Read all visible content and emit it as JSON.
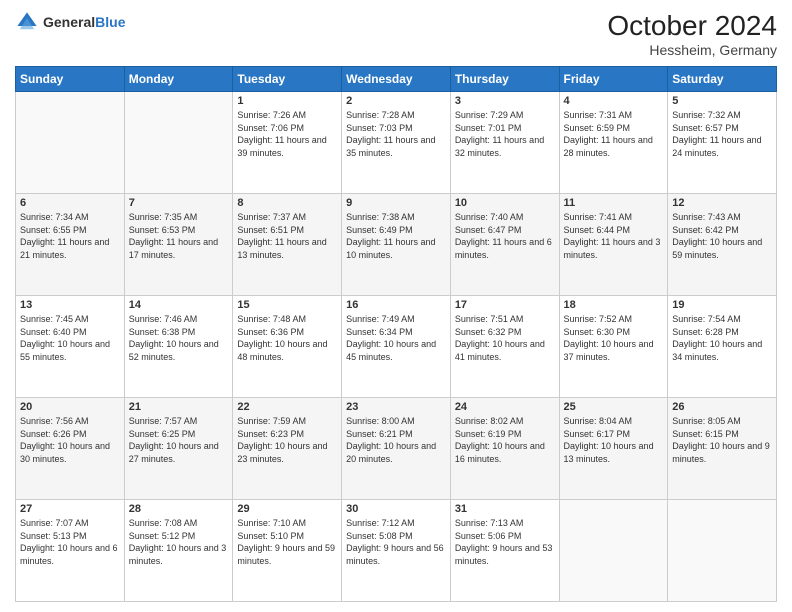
{
  "header": {
    "logo_line1": "General",
    "logo_line2": "Blue",
    "month_title": "October 2024",
    "location": "Hessheim, Germany"
  },
  "days_of_week": [
    "Sunday",
    "Monday",
    "Tuesday",
    "Wednesday",
    "Thursday",
    "Friday",
    "Saturday"
  ],
  "weeks": [
    [
      {
        "day": "",
        "sunrise": "",
        "sunset": "",
        "daylight": ""
      },
      {
        "day": "",
        "sunrise": "",
        "sunset": "",
        "daylight": ""
      },
      {
        "day": "1",
        "sunrise": "Sunrise: 7:26 AM",
        "sunset": "Sunset: 7:06 PM",
        "daylight": "Daylight: 11 hours and 39 minutes."
      },
      {
        "day": "2",
        "sunrise": "Sunrise: 7:28 AM",
        "sunset": "Sunset: 7:03 PM",
        "daylight": "Daylight: 11 hours and 35 minutes."
      },
      {
        "day": "3",
        "sunrise": "Sunrise: 7:29 AM",
        "sunset": "Sunset: 7:01 PM",
        "daylight": "Daylight: 11 hours and 32 minutes."
      },
      {
        "day": "4",
        "sunrise": "Sunrise: 7:31 AM",
        "sunset": "Sunset: 6:59 PM",
        "daylight": "Daylight: 11 hours and 28 minutes."
      },
      {
        "day": "5",
        "sunrise": "Sunrise: 7:32 AM",
        "sunset": "Sunset: 6:57 PM",
        "daylight": "Daylight: 11 hours and 24 minutes."
      }
    ],
    [
      {
        "day": "6",
        "sunrise": "Sunrise: 7:34 AM",
        "sunset": "Sunset: 6:55 PM",
        "daylight": "Daylight: 11 hours and 21 minutes."
      },
      {
        "day": "7",
        "sunrise": "Sunrise: 7:35 AM",
        "sunset": "Sunset: 6:53 PM",
        "daylight": "Daylight: 11 hours and 17 minutes."
      },
      {
        "day": "8",
        "sunrise": "Sunrise: 7:37 AM",
        "sunset": "Sunset: 6:51 PM",
        "daylight": "Daylight: 11 hours and 13 minutes."
      },
      {
        "day": "9",
        "sunrise": "Sunrise: 7:38 AM",
        "sunset": "Sunset: 6:49 PM",
        "daylight": "Daylight: 11 hours and 10 minutes."
      },
      {
        "day": "10",
        "sunrise": "Sunrise: 7:40 AM",
        "sunset": "Sunset: 6:47 PM",
        "daylight": "Daylight: 11 hours and 6 minutes."
      },
      {
        "day": "11",
        "sunrise": "Sunrise: 7:41 AM",
        "sunset": "Sunset: 6:44 PM",
        "daylight": "Daylight: 11 hours and 3 minutes."
      },
      {
        "day": "12",
        "sunrise": "Sunrise: 7:43 AM",
        "sunset": "Sunset: 6:42 PM",
        "daylight": "Daylight: 10 hours and 59 minutes."
      }
    ],
    [
      {
        "day": "13",
        "sunrise": "Sunrise: 7:45 AM",
        "sunset": "Sunset: 6:40 PM",
        "daylight": "Daylight: 10 hours and 55 minutes."
      },
      {
        "day": "14",
        "sunrise": "Sunrise: 7:46 AM",
        "sunset": "Sunset: 6:38 PM",
        "daylight": "Daylight: 10 hours and 52 minutes."
      },
      {
        "day": "15",
        "sunrise": "Sunrise: 7:48 AM",
        "sunset": "Sunset: 6:36 PM",
        "daylight": "Daylight: 10 hours and 48 minutes."
      },
      {
        "day": "16",
        "sunrise": "Sunrise: 7:49 AM",
        "sunset": "Sunset: 6:34 PM",
        "daylight": "Daylight: 10 hours and 45 minutes."
      },
      {
        "day": "17",
        "sunrise": "Sunrise: 7:51 AM",
        "sunset": "Sunset: 6:32 PM",
        "daylight": "Daylight: 10 hours and 41 minutes."
      },
      {
        "day": "18",
        "sunrise": "Sunrise: 7:52 AM",
        "sunset": "Sunset: 6:30 PM",
        "daylight": "Daylight: 10 hours and 37 minutes."
      },
      {
        "day": "19",
        "sunrise": "Sunrise: 7:54 AM",
        "sunset": "Sunset: 6:28 PM",
        "daylight": "Daylight: 10 hours and 34 minutes."
      }
    ],
    [
      {
        "day": "20",
        "sunrise": "Sunrise: 7:56 AM",
        "sunset": "Sunset: 6:26 PM",
        "daylight": "Daylight: 10 hours and 30 minutes."
      },
      {
        "day": "21",
        "sunrise": "Sunrise: 7:57 AM",
        "sunset": "Sunset: 6:25 PM",
        "daylight": "Daylight: 10 hours and 27 minutes."
      },
      {
        "day": "22",
        "sunrise": "Sunrise: 7:59 AM",
        "sunset": "Sunset: 6:23 PM",
        "daylight": "Daylight: 10 hours and 23 minutes."
      },
      {
        "day": "23",
        "sunrise": "Sunrise: 8:00 AM",
        "sunset": "Sunset: 6:21 PM",
        "daylight": "Daylight: 10 hours and 20 minutes."
      },
      {
        "day": "24",
        "sunrise": "Sunrise: 8:02 AM",
        "sunset": "Sunset: 6:19 PM",
        "daylight": "Daylight: 10 hours and 16 minutes."
      },
      {
        "day": "25",
        "sunrise": "Sunrise: 8:04 AM",
        "sunset": "Sunset: 6:17 PM",
        "daylight": "Daylight: 10 hours and 13 minutes."
      },
      {
        "day": "26",
        "sunrise": "Sunrise: 8:05 AM",
        "sunset": "Sunset: 6:15 PM",
        "daylight": "Daylight: 10 hours and 9 minutes."
      }
    ],
    [
      {
        "day": "27",
        "sunrise": "Sunrise: 7:07 AM",
        "sunset": "Sunset: 5:13 PM",
        "daylight": "Daylight: 10 hours and 6 minutes."
      },
      {
        "day": "28",
        "sunrise": "Sunrise: 7:08 AM",
        "sunset": "Sunset: 5:12 PM",
        "daylight": "Daylight: 10 hours and 3 minutes."
      },
      {
        "day": "29",
        "sunrise": "Sunrise: 7:10 AM",
        "sunset": "Sunset: 5:10 PM",
        "daylight": "Daylight: 9 hours and 59 minutes."
      },
      {
        "day": "30",
        "sunrise": "Sunrise: 7:12 AM",
        "sunset": "Sunset: 5:08 PM",
        "daylight": "Daylight: 9 hours and 56 minutes."
      },
      {
        "day": "31",
        "sunrise": "Sunrise: 7:13 AM",
        "sunset": "Sunset: 5:06 PM",
        "daylight": "Daylight: 9 hours and 53 minutes."
      },
      {
        "day": "",
        "sunrise": "",
        "sunset": "",
        "daylight": ""
      },
      {
        "day": "",
        "sunrise": "",
        "sunset": "",
        "daylight": ""
      }
    ]
  ]
}
